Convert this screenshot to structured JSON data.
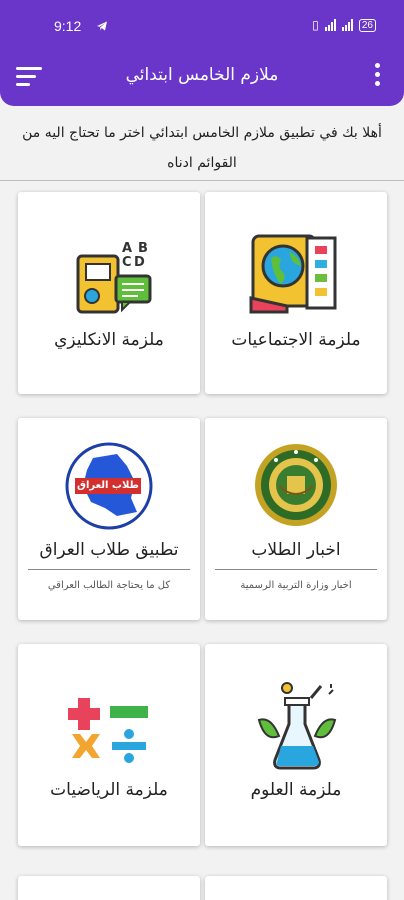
{
  "status": {
    "time": "9:12",
    "battery": "26"
  },
  "appbar": {
    "title": "ملازم الخامس ابتدائي"
  },
  "welcome": "أهلا بك في تطبيق ملازم الخامس ابتدائي اختر ما تحتاج اليه من القوائم ادناه",
  "logo": {
    "iraq_students_text": "طلاب العراق"
  },
  "cards": {
    "social": {
      "label": "ملزمة الاجتماعيات",
      "icon": "globe-book-icon"
    },
    "english": {
      "label": "ملزمة الانكليزي",
      "icon": "english-book-icon"
    },
    "news": {
      "label": "اخبار الطلاب",
      "sub": "اخبار وزارة التربية الرسمية",
      "icon": "ministry-seal-icon"
    },
    "iraq": {
      "label": "تطبيق طلاب العراق",
      "sub": "كل ما يحتاجة الطالب العراقي",
      "icon": "iraq-students-logo-icon"
    },
    "science": {
      "label": "ملزمة العلوم",
      "icon": "flask-leaves-icon"
    },
    "math": {
      "label": "ملزمة الرياضيات",
      "icon": "math-operators-icon"
    }
  },
  "colors": {
    "primary": "#6a35c9",
    "background": "#f2f2f2",
    "card": "#ffffff"
  }
}
